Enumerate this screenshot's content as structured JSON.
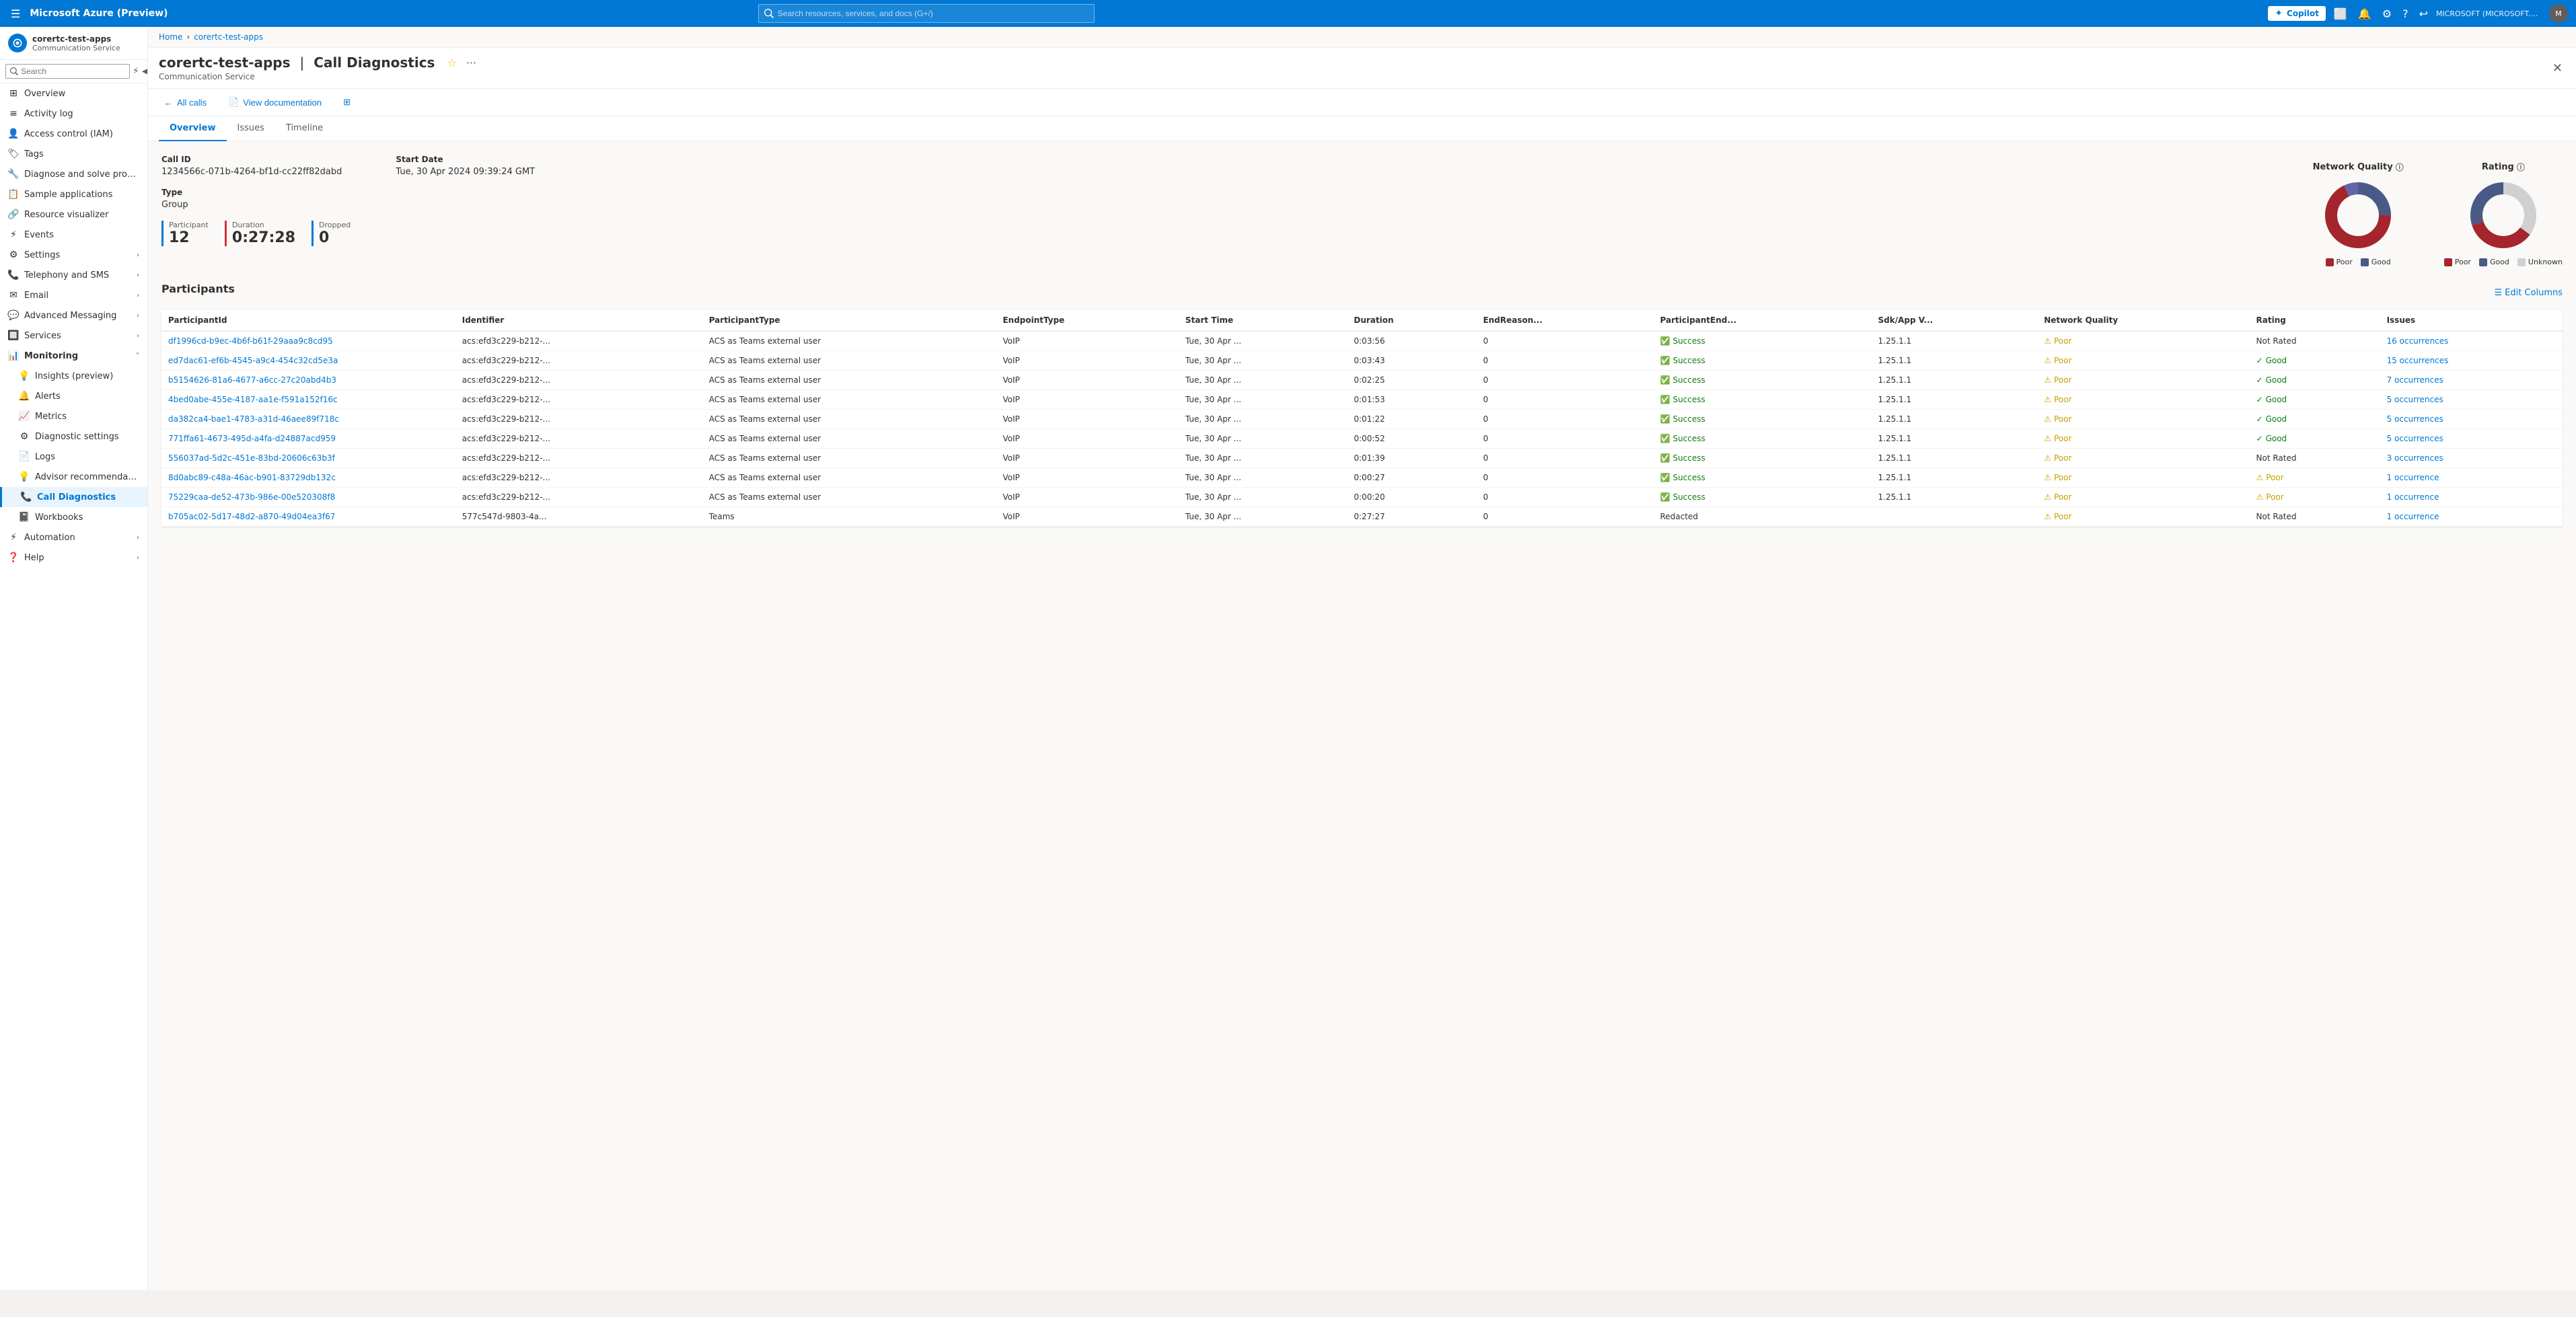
{
  "topbar": {
    "title": "Microsoft Azure (Preview)",
    "search_placeholder": "Search resources, services, and docs (G+/)",
    "copilot_label": "Copilot",
    "user_text": "MICROSOFT (MICROSOFT.ONMI...",
    "avatar_initials": "M"
  },
  "breadcrumb": {
    "home": "Home",
    "separator": ">",
    "current": "corertc-test-apps"
  },
  "page": {
    "resource_name": "corertc-test-apps",
    "separator": "|",
    "page_title": "Call Diagnostics",
    "resource_type": "Communication Service"
  },
  "toolbar": {
    "back_label": "All calls",
    "view_docs_label": "View documentation"
  },
  "tabs": [
    {
      "id": "overview",
      "label": "Overview",
      "active": true
    },
    {
      "id": "issues",
      "label": "Issues",
      "active": false
    },
    {
      "id": "timeline",
      "label": "Timeline",
      "active": false
    }
  ],
  "call_info": {
    "call_id_label": "Call ID",
    "call_id_value": "1234566c-071b-4264-bf1d-cc22ff82dabd",
    "start_date_label": "Start Date",
    "start_date_value": "Tue, 30 Apr 2024 09:39:24 GMT",
    "type_label": "Type",
    "type_value": "Group"
  },
  "stats": [
    {
      "label": "Participant",
      "value": "12",
      "color": "#0078d4"
    },
    {
      "label": "Duration",
      "value": "0:27:28",
      "color": "#d13438"
    },
    {
      "label": "Dropped",
      "value": "0",
      "color": "#0078d4"
    }
  ],
  "network_quality_chart": {
    "title": "Network Quality",
    "poor_pct": 68,
    "good_pct": 25,
    "other_pct": 7,
    "poor_color": "#a4262c",
    "good_color": "#4a5a87",
    "legend": [
      {
        "label": "Poor",
        "color": "#a4262c"
      },
      {
        "label": "Good",
        "color": "#4a5a87"
      }
    ]
  },
  "rating_chart": {
    "title": "Rating",
    "poor_pct": 35,
    "good_pct": 30,
    "unknown_pct": 35,
    "poor_color": "#a4262c",
    "good_color": "#4a5a87",
    "unknown_color": "#e0e0e0",
    "legend": [
      {
        "label": "Poor",
        "color": "#a4262c"
      },
      {
        "label": "Good",
        "color": "#4a5a87"
      },
      {
        "label": "Unknown",
        "color": "#e0e0e0"
      }
    ]
  },
  "participants_section": {
    "title": "Participants",
    "edit_columns_label": "Edit Columns",
    "columns": [
      "ParticipantId",
      "Identifier",
      "ParticipantType",
      "EndpointType",
      "Start Time",
      "Duration",
      "EndReason...",
      "ParticipantEnd...",
      "Sdk/App V...",
      "Network Quality",
      "Rating",
      "Issues"
    ],
    "rows": [
      {
        "id": "df1996cd-b9ec-4b6f-b61f-29aaa9c8cd95",
        "identifier": "acs:efd3c229-b212-...",
        "participant_type": "ACS as Teams external user",
        "endpoint_type": "VoIP",
        "start_time": "Tue, 30 Apr ...",
        "duration": "0:03:56",
        "end_reason": "0",
        "participant_end": "Success",
        "sdk_app_v": "1.25.1.1",
        "network_quality": "Poor",
        "rating": "Not Rated",
        "issues": "16 occurrences",
        "issues_link": true
      },
      {
        "id": "ed7dac61-ef6b-4545-a9c4-454c32cd5e3a",
        "identifier": "acs:efd3c229-b212-...",
        "participant_type": "ACS as Teams external user",
        "endpoint_type": "VoIP",
        "start_time": "Tue, 30 Apr ...",
        "duration": "0:03:43",
        "end_reason": "0",
        "participant_end": "Success",
        "sdk_app_v": "1.25.1.1",
        "network_quality": "Poor",
        "rating": "Good",
        "issues": "15 occurrences",
        "issues_link": true
      },
      {
        "id": "b5154626-81a6-4677-a6cc-27c20abd4b3",
        "identifier": "acs:efd3c229-b212-...",
        "participant_type": "ACS as Teams external user",
        "endpoint_type": "VoIP",
        "start_time": "Tue, 30 Apr ...",
        "duration": "0:02:25",
        "end_reason": "0",
        "participant_end": "Success",
        "sdk_app_v": "1.25.1.1",
        "network_quality": "Poor",
        "rating": "Good",
        "issues": "7 occurrences",
        "issues_link": true
      },
      {
        "id": "4bed0abe-455e-4187-aa1e-f591a152f16c",
        "identifier": "acs:efd3c229-b212-...",
        "participant_type": "ACS as Teams external user",
        "endpoint_type": "VoIP",
        "start_time": "Tue, 30 Apr ...",
        "duration": "0:01:53",
        "end_reason": "0",
        "participant_end": "Success",
        "sdk_app_v": "1.25.1.1",
        "network_quality": "Poor",
        "rating": "Good",
        "issues": "5 occurrences",
        "issues_link": true
      },
      {
        "id": "da382ca4-bae1-4783-a31d-46aee89f718c",
        "identifier": "acs:efd3c229-b212-...",
        "participant_type": "ACS as Teams external user",
        "endpoint_type": "VoIP",
        "start_time": "Tue, 30 Apr ...",
        "duration": "0:01:22",
        "end_reason": "0",
        "participant_end": "Success",
        "sdk_app_v": "1.25.1.1",
        "network_quality": "Poor",
        "rating": "Good",
        "issues": "5 occurrences",
        "issues_link": true
      },
      {
        "id": "771ffa61-4673-495d-a4fa-d24887acd959",
        "identifier": "acs:efd3c229-b212-...",
        "participant_type": "ACS as Teams external user",
        "endpoint_type": "VoIP",
        "start_time": "Tue, 30 Apr ...",
        "duration": "0:00:52",
        "end_reason": "0",
        "participant_end": "Success",
        "sdk_app_v": "1.25.1.1",
        "network_quality": "Poor",
        "rating": "Good",
        "issues": "5 occurrences",
        "issues_link": true
      },
      {
        "id": "556037ad-5d2c-451e-83bd-20606c63b3f",
        "identifier": "acs:efd3c229-b212-...",
        "participant_type": "ACS as Teams external user",
        "endpoint_type": "VoIP",
        "start_time": "Tue, 30 Apr ...",
        "duration": "0:01:39",
        "end_reason": "0",
        "participant_end": "Success",
        "sdk_app_v": "1.25.1.1",
        "network_quality": "Poor",
        "rating": "Not Rated",
        "issues": "3 occurrences",
        "issues_link": true
      },
      {
        "id": "8d0abc89-c48a-46ac-b901-83729db132c",
        "identifier": "acs:efd3c229-b212-...",
        "participant_type": "ACS as Teams external user",
        "endpoint_type": "VoIP",
        "start_time": "Tue, 30 Apr ...",
        "duration": "0:00:27",
        "end_reason": "0",
        "participant_end": "Success",
        "sdk_app_v": "1.25.1.1",
        "network_quality": "Poor",
        "rating": "Poor",
        "issues": "1 occurrence",
        "issues_link": true
      },
      {
        "id": "75229caa-de52-473b-986e-00e520308f8",
        "identifier": "acs:efd3c229-b212-...",
        "participant_type": "ACS as Teams external user",
        "endpoint_type": "VoIP",
        "start_time": "Tue, 30 Apr ...",
        "duration": "0:00:20",
        "end_reason": "0",
        "participant_end": "Success",
        "sdk_app_v": "1.25.1.1",
        "network_quality": "Poor",
        "rating": "Poor",
        "issues": "1 occurrence",
        "issues_link": true
      },
      {
        "id": "b705ac02-5d17-48d2-a870-49d04ea3f67",
        "identifier": "577c547d-9803-4a...",
        "participant_type": "Teams",
        "endpoint_type": "VoIP",
        "start_time": "Tue, 30 Apr ...",
        "duration": "0:27:27",
        "end_reason": "0",
        "participant_end": "Redacted",
        "sdk_app_v": "",
        "network_quality": "Poor",
        "rating": "Not Rated",
        "issues": "1 occurrence",
        "issues_link": true
      }
    ]
  },
  "sidebar": {
    "items": [
      {
        "id": "overview",
        "label": "Overview",
        "icon": "grid",
        "level": 0
      },
      {
        "id": "activity-log",
        "label": "Activity log",
        "icon": "list",
        "level": 0
      },
      {
        "id": "access-control",
        "label": "Access control (IAM)",
        "icon": "person",
        "level": 0
      },
      {
        "id": "tags",
        "label": "Tags",
        "icon": "tag",
        "level": 0
      },
      {
        "id": "diagnose",
        "label": "Diagnose and solve problems",
        "icon": "wrench",
        "level": 0
      },
      {
        "id": "sample-apps",
        "label": "Sample applications",
        "icon": "app",
        "level": 0
      },
      {
        "id": "resource-visualizer",
        "label": "Resource visualizer",
        "icon": "network",
        "level": 0
      },
      {
        "id": "events",
        "label": "Events",
        "icon": "lightning",
        "level": 0
      },
      {
        "id": "settings",
        "label": "Settings",
        "icon": "settings",
        "level": 0,
        "expandable": true
      },
      {
        "id": "telephony-sms",
        "label": "Telephony and SMS",
        "icon": "phone",
        "level": 0,
        "expandable": true
      },
      {
        "id": "email",
        "label": "Email",
        "icon": "email",
        "level": 0,
        "expandable": true
      },
      {
        "id": "advanced-messaging",
        "label": "Advanced Messaging",
        "icon": "message",
        "level": 0,
        "expandable": true
      },
      {
        "id": "services",
        "label": "Services",
        "icon": "services",
        "level": 0,
        "expandable": true
      },
      {
        "id": "monitoring",
        "label": "Monitoring",
        "icon": "monitor",
        "level": 0,
        "expanded": true
      },
      {
        "id": "insights",
        "label": "Insights (preview)",
        "icon": "insights",
        "level": 1
      },
      {
        "id": "alerts",
        "label": "Alerts",
        "icon": "bell",
        "level": 1
      },
      {
        "id": "metrics",
        "label": "Metrics",
        "icon": "bar-chart",
        "level": 1
      },
      {
        "id": "diagnostic-settings",
        "label": "Diagnostic settings",
        "icon": "settings2",
        "level": 1
      },
      {
        "id": "logs",
        "label": "Logs",
        "icon": "logs",
        "level": 1
      },
      {
        "id": "advisor-recommendations",
        "label": "Advisor recommendations",
        "icon": "advisor",
        "level": 1
      },
      {
        "id": "call-diagnostics",
        "label": "Call Diagnostics",
        "icon": "call",
        "level": 1,
        "active": true
      },
      {
        "id": "workbooks",
        "label": "Workbooks",
        "icon": "book",
        "level": 1
      },
      {
        "id": "automation",
        "label": "Automation",
        "icon": "automation",
        "level": 0,
        "expandable": true
      },
      {
        "id": "help",
        "label": "Help",
        "icon": "help",
        "level": 0,
        "expandable": true
      }
    ]
  }
}
